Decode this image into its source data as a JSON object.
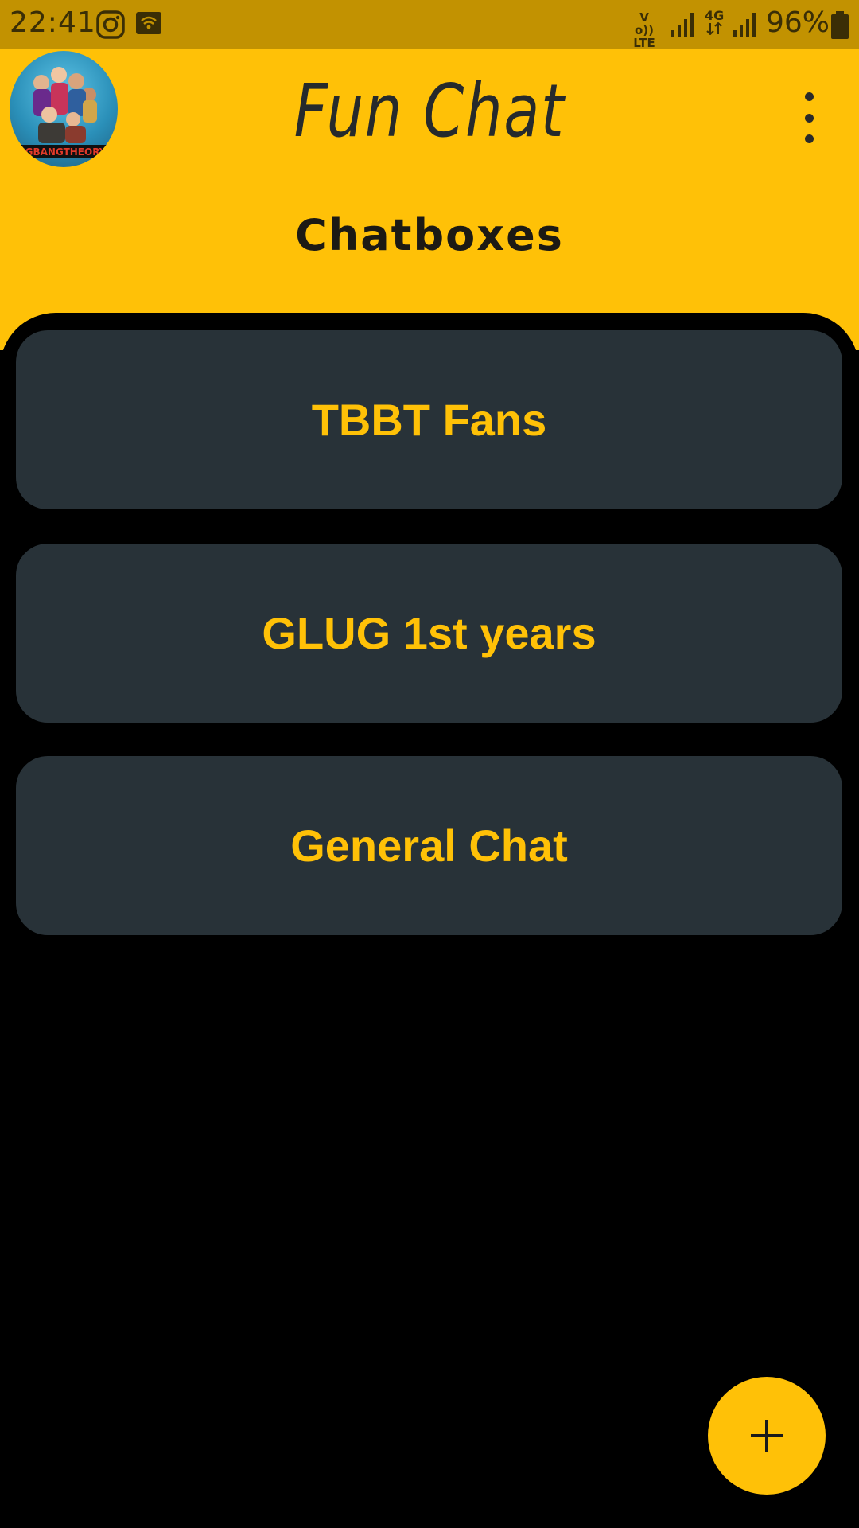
{
  "status_bar": {
    "time": "22:41",
    "network_volte": "Vo)) LTE",
    "network_4g": "4G",
    "battery": "96%"
  },
  "header": {
    "title": "Fun Chat",
    "section_title": "Chatboxes",
    "avatar_icon": "tbbt-avatar",
    "menu_icon": "more-vert-icon"
  },
  "chats": [
    {
      "label": "TBBT Fans"
    },
    {
      "label": "GLUG 1st years"
    },
    {
      "label": "General Chat"
    }
  ],
  "fab": {
    "icon": "plus-icon"
  },
  "colors": {
    "status_bar": "#C29201",
    "accent": "#FFC107",
    "card": "#283238",
    "background": "#000000"
  }
}
